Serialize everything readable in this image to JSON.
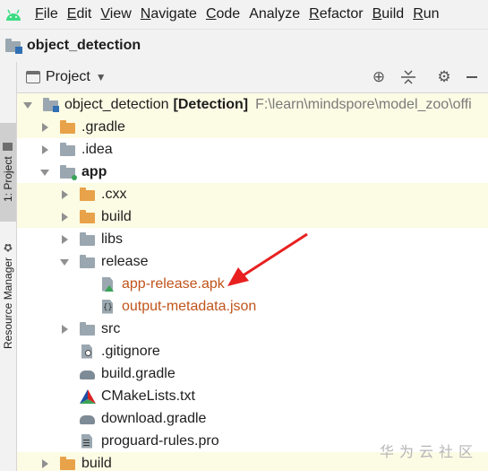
{
  "menubar": {
    "items": [
      {
        "mnemonic": "F",
        "rest": "ile"
      },
      {
        "mnemonic": "E",
        "rest": "dit"
      },
      {
        "mnemonic": "V",
        "rest": "iew"
      },
      {
        "mnemonic": "N",
        "rest": "avigate"
      },
      {
        "mnemonic": "C",
        "rest": "ode"
      },
      {
        "mnemonic": "",
        "rest": "Analyze"
      },
      {
        "mnemonic": "R",
        "rest": "efactor"
      },
      {
        "mnemonic": "B",
        "rest": "uild"
      },
      {
        "mnemonic": "R",
        "rest": "un"
      }
    ]
  },
  "navbar": {
    "title": "object_detection"
  },
  "sidebar": {
    "project_tab": "1: Project",
    "resource_tab": "Resource Manager"
  },
  "toolbar": {
    "title": "Project",
    "icons": [
      "locate-icon",
      "collapse-all-icon",
      "gear-icon",
      "minimize-icon"
    ]
  },
  "tree": {
    "root": {
      "name": "object_detection",
      "module": "[Detection]",
      "path": "F:\\learn\\mindspore\\model_zoo\\offi"
    },
    "items": [
      {
        "label": ".gradle"
      },
      {
        "label": ".idea"
      },
      {
        "label": "app"
      },
      {
        "label": ".cxx"
      },
      {
        "label": "build"
      },
      {
        "label": "libs"
      },
      {
        "label": "release"
      },
      {
        "label": "app-release.apk"
      },
      {
        "label": "output-metadata.json"
      },
      {
        "label": "src"
      },
      {
        "label": ".gitignore"
      },
      {
        "label": "build.gradle"
      },
      {
        "label": "CMakeLists.txt"
      },
      {
        "label": "download.gradle"
      },
      {
        "label": "proguard-rules.pro"
      },
      {
        "label": "build"
      }
    ]
  },
  "watermark": "华为云社区",
  "colors": {
    "pointer_arrow": "#e82020",
    "highlight_row": "#fcfbe4",
    "orange_folder": "#e8a249"
  }
}
